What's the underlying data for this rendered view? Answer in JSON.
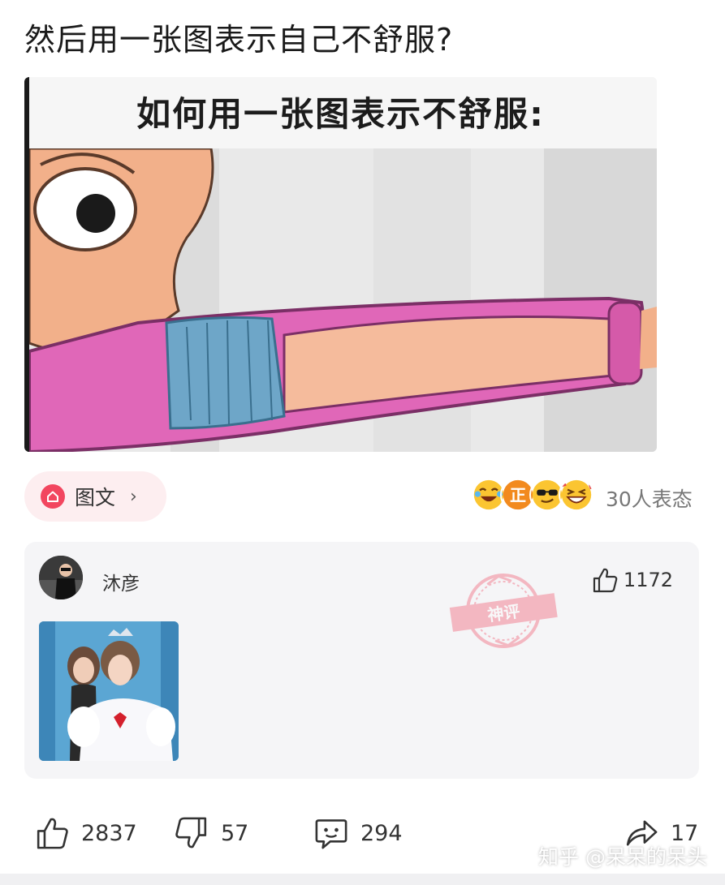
{
  "post": {
    "title": "然后用一张图表示自己不舒服?"
  },
  "meme": {
    "caption": "如何用一张图表示不舒服:"
  },
  "tag": {
    "label": "图文",
    "chevron": "›",
    "icon": "home-icon"
  },
  "reactions": {
    "count_text": "30人表态",
    "emojis": [
      "laugh-cry-emoji",
      "zheng-emoji",
      "sunglasses-emoji",
      "grin-emoji"
    ],
    "badge_char": "正"
  },
  "comment": {
    "username": "沐彦",
    "likes": "1172",
    "stamp_text": "神评"
  },
  "actions": {
    "upvotes": "2837",
    "downvotes": "57",
    "comments": "294",
    "shares": "17"
  },
  "watermark": "知乎 @呆呆的呆头",
  "colors": {
    "accent": "#f2465f",
    "card": "#f5f5f7",
    "pill": "#fdeef0"
  }
}
